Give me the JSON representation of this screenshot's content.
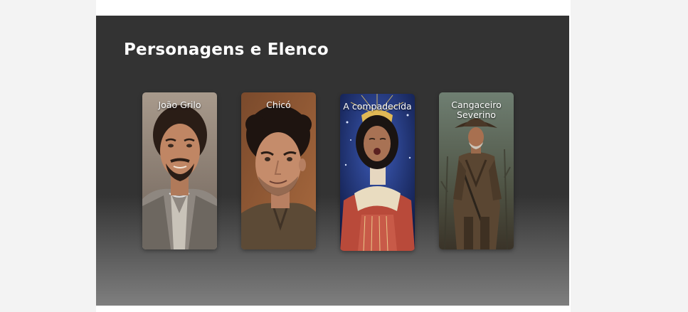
{
  "section": {
    "title": "Personagens e Elenco"
  },
  "characters": [
    {
      "name": "João Grilo",
      "image": "joao-grilo-portrait"
    },
    {
      "name": "Chicó",
      "image": "chico-portrait"
    },
    {
      "name": "A compadecida",
      "image": "a-compadecida-portrait"
    },
    {
      "name": "Cangaceiro Severino",
      "image": "cangaceiro-severino-portrait"
    }
  ],
  "colors": {
    "section_background_top": "#333333",
    "section_background_bottom": "#7f7f7f",
    "page_background": "#f3f3f3",
    "content_background": "#ffffff",
    "text": "#ffffff"
  }
}
